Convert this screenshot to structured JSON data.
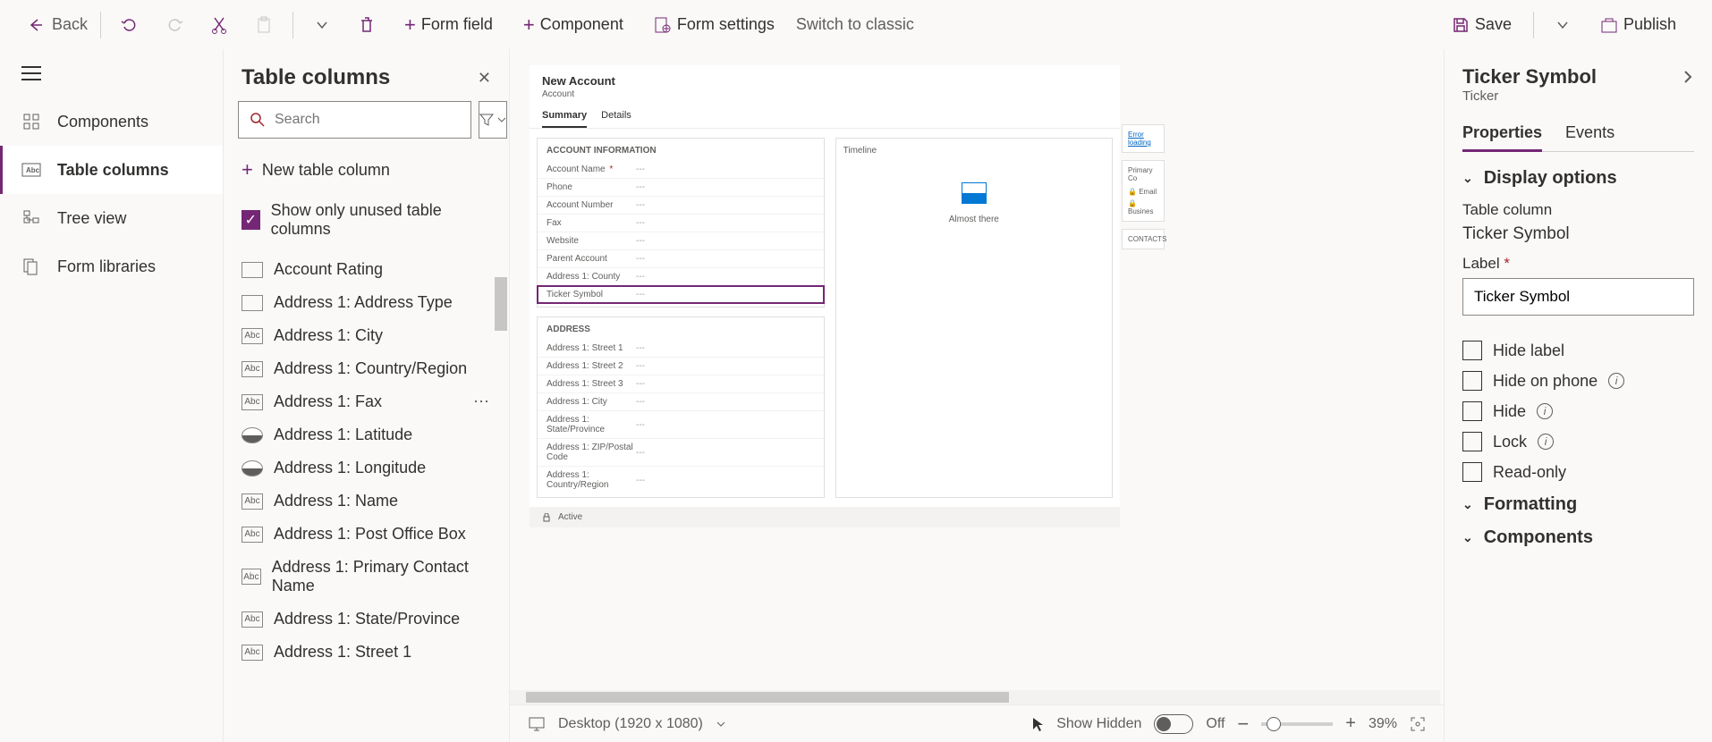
{
  "topbar": {
    "back": "Back",
    "form_field": "Form field",
    "component": "Component",
    "form_settings": "Form settings",
    "switch_classic": "Switch to classic",
    "save": "Save",
    "publish": "Publish"
  },
  "leftrail": {
    "components": "Components",
    "table_columns": "Table columns",
    "tree_view": "Tree view",
    "form_libraries": "Form libraries"
  },
  "midpanel": {
    "title": "Table columns",
    "search_placeholder": "Search",
    "new_column": "New table column",
    "show_unused": "Show only unused table columns",
    "columns": [
      {
        "name": "Account Rating",
        "type": "option"
      },
      {
        "name": "Address 1: Address Type",
        "type": "option"
      },
      {
        "name": "Address 1: City",
        "type": "text"
      },
      {
        "name": "Address 1: Country/Region",
        "type": "text"
      },
      {
        "name": "Address 1: Fax",
        "type": "text",
        "hover": true
      },
      {
        "name": "Address 1: Latitude",
        "type": "float"
      },
      {
        "name": "Address 1: Longitude",
        "type": "float"
      },
      {
        "name": "Address 1: Name",
        "type": "text"
      },
      {
        "name": "Address 1: Post Office Box",
        "type": "text"
      },
      {
        "name": "Address 1: Primary Contact Name",
        "type": "text"
      },
      {
        "name": "Address 1: State/Province",
        "type": "text"
      },
      {
        "name": "Address 1: Street 1",
        "type": "text"
      }
    ]
  },
  "canvas": {
    "form_title": "New Account",
    "form_subtitle": "Account",
    "tabs": [
      "Summary",
      "Details"
    ],
    "section1_title": "ACCOUNT INFORMATION",
    "section1_fields": [
      {
        "label": "Account Name",
        "required": true,
        "value": "---"
      },
      {
        "label": "Phone",
        "value": "---"
      },
      {
        "label": "Account Number",
        "value": "---"
      },
      {
        "label": "Fax",
        "value": "---"
      },
      {
        "label": "Website",
        "value": "---"
      },
      {
        "label": "Parent Account",
        "value": "---"
      },
      {
        "label": "Address 1: County",
        "value": "---"
      },
      {
        "label": "Ticker Symbol",
        "value": "---",
        "selected": true
      }
    ],
    "section2_title": "ADDRESS",
    "section2_fields": [
      {
        "label": "Address 1: Street 1",
        "value": "---"
      },
      {
        "label": "Address 1: Street 2",
        "value": "---"
      },
      {
        "label": "Address 1: Street 3",
        "value": "---"
      },
      {
        "label": "Address 1: City",
        "value": "---"
      },
      {
        "label": "Address 1: State/Province",
        "value": "---"
      },
      {
        "label": "Address 1: ZIP/Postal Code",
        "value": "---"
      },
      {
        "label": "Address 1: Country/Region",
        "value": "---"
      }
    ],
    "timeline_title": "Timeline",
    "timeline_text": "Almost there",
    "error_loading": "Error loading",
    "primary_contact": "Primary Co",
    "email": "Email",
    "business": "Busines",
    "contacts": "CONTACTS",
    "status": "Active"
  },
  "rightpanel": {
    "title": "Ticker Symbol",
    "subtitle": "Ticker",
    "tabs": [
      "Properties",
      "Events"
    ],
    "display_options": "Display options",
    "table_column_label": "Table column",
    "table_column_value": "Ticker Symbol",
    "label_label": "Label",
    "label_value": "Ticker Symbol",
    "hide_label": "Hide label",
    "hide_phone": "Hide on phone",
    "hide": "Hide",
    "lock": "Lock",
    "readonly": "Read-only",
    "formatting": "Formatting",
    "components": "Components"
  },
  "statusbar": {
    "desktop": "Desktop (1920 x 1080)",
    "show_hidden": "Show Hidden",
    "toggle_state": "Off",
    "zoom": "39%"
  }
}
